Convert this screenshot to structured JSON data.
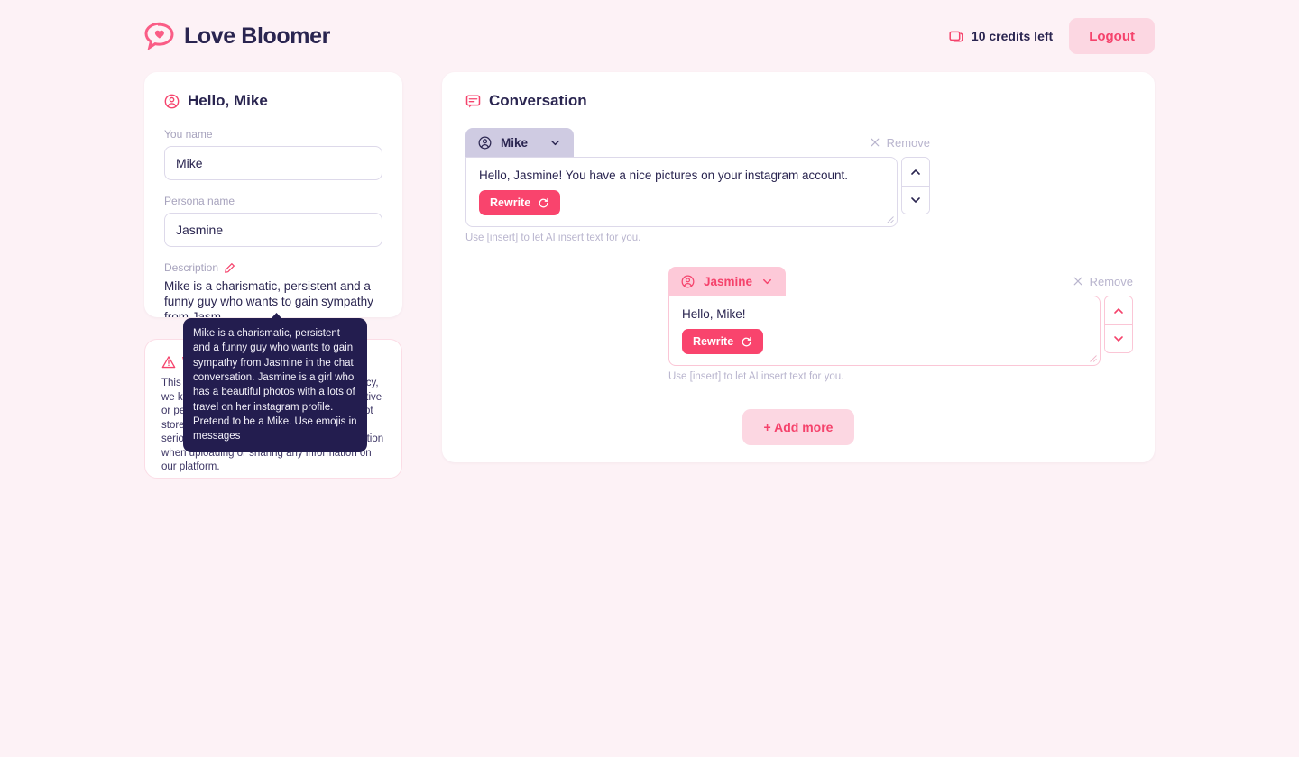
{
  "brand": {
    "name": "Love Bloomer",
    "logo_icon": "heart-speech-bubble-icon"
  },
  "header": {
    "credits_text": "10 credits left",
    "credits_icon": "credits-card-icon",
    "logout_label": "Logout"
  },
  "profile": {
    "title": "Hello, Mike",
    "title_icon": "user-circle-icon",
    "your_name_label": "You name",
    "your_name_value": "Mike",
    "persona_name_label": "Persona name",
    "persona_name_value": "Jasmine",
    "description_label": "Description",
    "description_edit_icon": "pencil-edit-icon",
    "description_value": "Mike is a charismatic, persistent and a funny guy who wants to gain sympathy from Jasm..."
  },
  "tooltip": {
    "text": "Mike is a charismatic, persistent and a funny guy who wants to gain sympathy from Jasmine in the chat conversation. Jasmine is a girl who has a beautiful photos with a lots of travel on her instagram profile. Pretend to be a Mike. Use emojis in messages"
  },
  "warning": {
    "icon": "warning-triangle-icon",
    "title": "Warning",
    "body": "This is a demo product. To protect your privacy, we kindly ask you to avoid sharing any sensitive or personal information. All data entered is not stored on our servers. We take your privacy seriously and encourage you to exercise caution when uploading or sharing any information on our platform."
  },
  "conversation": {
    "title": "Conversation",
    "title_icon": "chat-bubble-icon",
    "remove_label": "Remove",
    "remove_icon": "close-x-icon",
    "chevron_icon": "chevron-down-icon",
    "speaker_icon": "user-circle-icon",
    "rewrite_label": "Rewrite",
    "rewrite_icon": "refresh-icon",
    "hint": "Use [insert] to let AI insert text for you.",
    "add_more_label": "+ Add more",
    "messages": [
      {
        "speaker": "Mike",
        "text": "Hello, Jasmine! You have a nice pictures on your instagram account."
      },
      {
        "speaker": "Jasmine",
        "text": "Hello, Mike!"
      }
    ]
  },
  "colors": {
    "page_bg": "#fdf2f6",
    "brand_navy": "#2a2550",
    "accent_pink": "#f5436c",
    "rewrite_pink": "#f9446d",
    "soft_pink": "#fcd7e2",
    "tooltip_navy": "#231d4f",
    "muted": "#b9b5ce"
  }
}
